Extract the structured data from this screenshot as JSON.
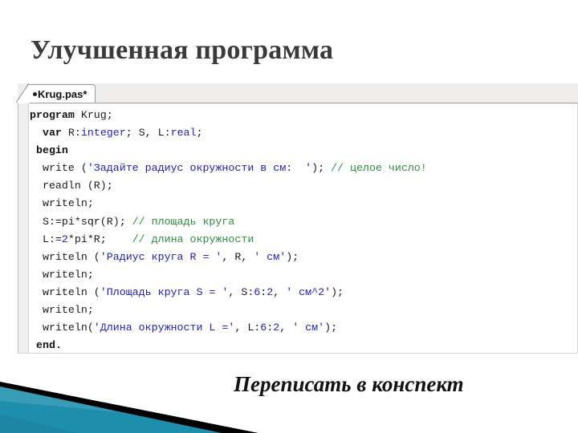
{
  "slide": {
    "title": "Улучшенная программа",
    "caption": "Переписать в конспект"
  },
  "editor": {
    "tab": {
      "modified_dot": "●",
      "label": "Krug.pas*"
    },
    "code_lines": [
      [
        {
          "t": "program",
          "c": "kw"
        },
        {
          "t": " Krug;",
          "c": "pln"
        }
      ],
      [
        {
          "t": "  ",
          "c": "pln"
        },
        {
          "t": "var",
          "c": "kw"
        },
        {
          "t": " R:",
          "c": "pln"
        },
        {
          "t": "integer",
          "c": "typ"
        },
        {
          "t": "; S, L:",
          "c": "pln"
        },
        {
          "t": "real",
          "c": "typ"
        },
        {
          "t": ";",
          "c": "pln"
        }
      ],
      [
        {
          "t": " ",
          "c": "pln"
        },
        {
          "t": "begin",
          "c": "kw"
        }
      ],
      [
        {
          "t": "  write (",
          "c": "pln"
        },
        {
          "t": "'Задайте радиус окружности в см:  '",
          "c": "str"
        },
        {
          "t": "); ",
          "c": "pln"
        },
        {
          "t": "// целое число!",
          "c": "cmt"
        }
      ],
      [
        {
          "t": "  readln (R);",
          "c": "pln"
        }
      ],
      [
        {
          "t": "  writeln;",
          "c": "pln"
        }
      ],
      [
        {
          "t": "  S:=pi*sqr(R); ",
          "c": "pln"
        },
        {
          "t": "// площадь круга",
          "c": "cmt"
        }
      ],
      [
        {
          "t": "  L:=",
          "c": "pln"
        },
        {
          "t": "2",
          "c": "num"
        },
        {
          "t": "*pi*R;    ",
          "c": "pln"
        },
        {
          "t": "// длина окружности",
          "c": "cmt"
        }
      ],
      [
        {
          "t": "  writeln (",
          "c": "pln"
        },
        {
          "t": "'Радиус круга R = '",
          "c": "str"
        },
        {
          "t": ", R, ",
          "c": "pln"
        },
        {
          "t": "' см'",
          "c": "str"
        },
        {
          "t": ");",
          "c": "pln"
        }
      ],
      [
        {
          "t": "  writeln;",
          "c": "pln"
        }
      ],
      [
        {
          "t": "  writeln (",
          "c": "pln"
        },
        {
          "t": "'Площадь круга S = '",
          "c": "str"
        },
        {
          "t": ", S:",
          "c": "pln"
        },
        {
          "t": "6",
          "c": "num"
        },
        {
          "t": ":",
          "c": "pln"
        },
        {
          "t": "2",
          "c": "num"
        },
        {
          "t": ", ",
          "c": "pln"
        },
        {
          "t": "' см^2'",
          "c": "str"
        },
        {
          "t": ");",
          "c": "pln"
        }
      ],
      [
        {
          "t": "  writeln;",
          "c": "pln"
        }
      ],
      [
        {
          "t": "  writeln(",
          "c": "pln"
        },
        {
          "t": "'Длина окружности L ='",
          "c": "str"
        },
        {
          "t": ", L:",
          "c": "pln"
        },
        {
          "t": "6",
          "c": "num"
        },
        {
          "t": ":",
          "c": "pln"
        },
        {
          "t": "2",
          "c": "num"
        },
        {
          "t": ", ",
          "c": "pln"
        },
        {
          "t": "' см'",
          "c": "str"
        },
        {
          "t": ");",
          "c": "pln"
        }
      ],
      [
        {
          "t": " ",
          "c": "pln"
        },
        {
          "t": "end",
          "c": "kw"
        },
        {
          "t": ".",
          "c": "kw"
        }
      ]
    ]
  },
  "theme": {
    "keyword_color": "#121212",
    "type_color": "#2222bb",
    "string_color": "#2222bb",
    "number_color": "#2222bb",
    "comment_color": "#2f8f3f",
    "decor_teal": "#1d8fad",
    "decor_teal_dark": "#0f6f8d",
    "decor_black": "#000000",
    "title_color": "#3a3a3a"
  }
}
